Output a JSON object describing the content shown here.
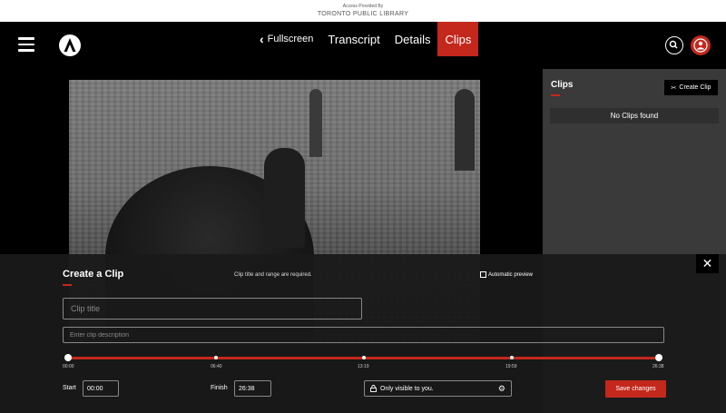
{
  "access_bar": {
    "line1": "Access Provided By",
    "line2": "TORONTO PUBLIC LIBRARY"
  },
  "nav": {
    "tabs": [
      {
        "label": "Fullscreen"
      },
      {
        "label": "Transcript"
      },
      {
        "label": "Details"
      },
      {
        "label": "Clips",
        "active": true
      }
    ]
  },
  "side_panel": {
    "title": "Clips",
    "create_button": "Create Clip",
    "empty_text": "No Clips found"
  },
  "create_clip": {
    "title": "Create a Clip",
    "required_note": "Clip title and range are required.",
    "auto_preview_label": "Automatic preview",
    "title_placeholder": "Clip title",
    "description_placeholder": "Enter clip description",
    "timeline_labels": [
      "00:00",
      "06:40",
      "13:19",
      "19:59",
      "26:38"
    ],
    "start_label": "Start",
    "start_value": "00:00",
    "finish_label": "Finish",
    "finish_value": "26:38",
    "visibility_text": "Only visible to you.",
    "save_label": "Save changes"
  },
  "colors": {
    "accent": "#c4281c",
    "panel": "#3a3a3a",
    "overlay": "#191919"
  },
  "icons": {
    "menu": "hamburger-icon",
    "back": "chevron-left-icon",
    "search": "search-icon",
    "user": "user-icon",
    "scissors": "scissors-icon",
    "close": "close-icon",
    "lock": "lock-icon",
    "gear": "gear-icon"
  }
}
